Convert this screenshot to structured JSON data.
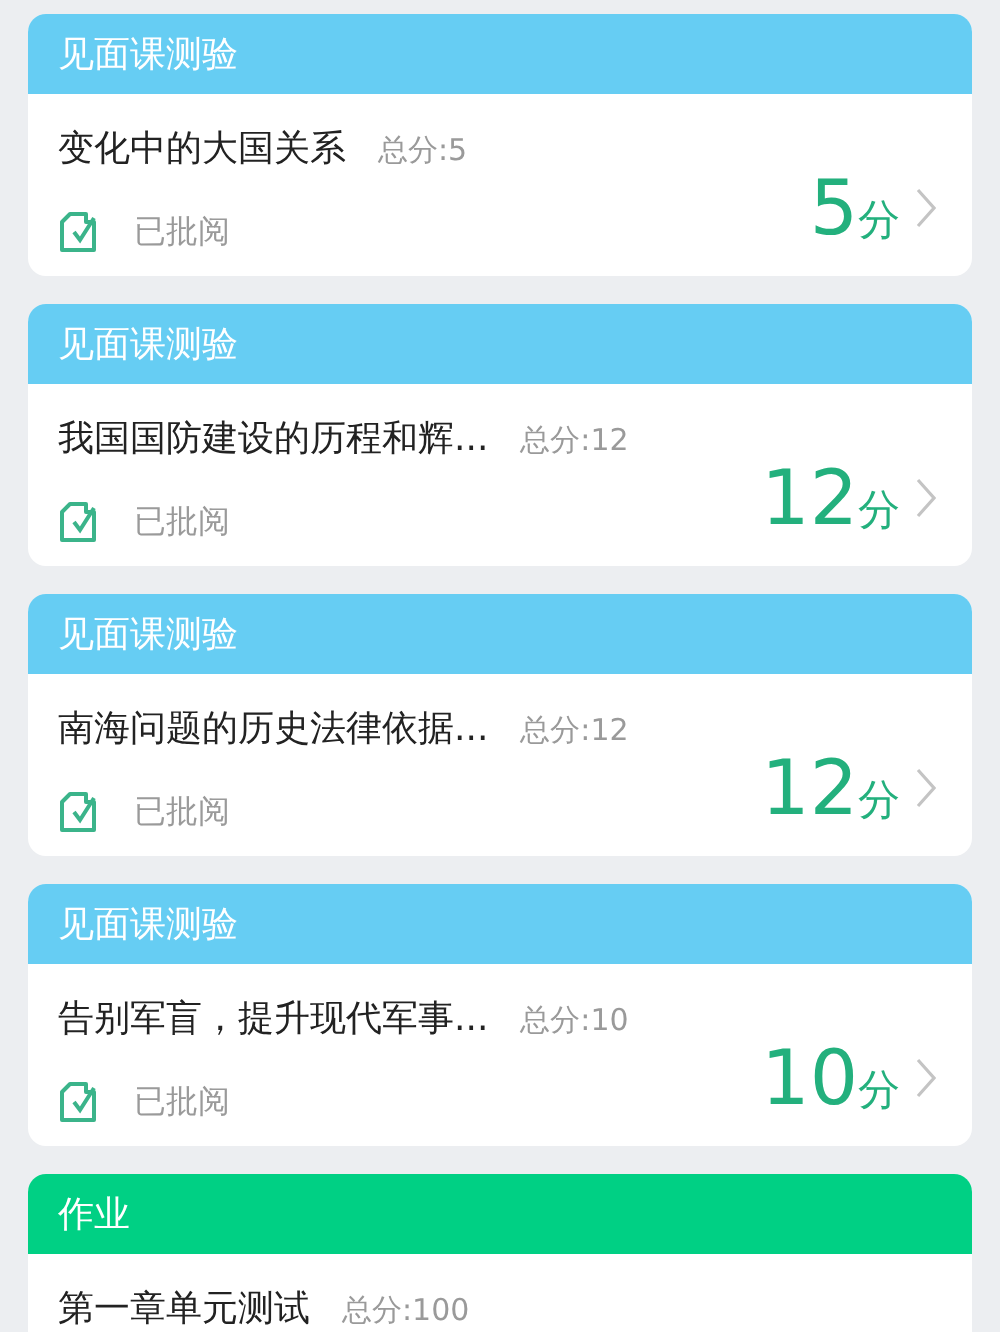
{
  "cards": [
    {
      "category": "见面课测验",
      "color": "#66cdf3",
      "title": "变化中的大国关系",
      "total": "总分:5",
      "status": "已批阅",
      "score": "5",
      "unit": "分"
    },
    {
      "category": "见面课测验",
      "color": "#66cdf3",
      "title": "我国国防建设的历程和辉...",
      "total": "总分:12",
      "status": "已批阅",
      "score": "12",
      "unit": "分"
    },
    {
      "category": "见面课测验",
      "color": "#66cdf3",
      "title": "南海问题的历史法律依据...",
      "total": "总分:12",
      "status": "已批阅",
      "score": "12",
      "unit": "分"
    },
    {
      "category": "见面课测验",
      "color": "#66cdf3",
      "title": "告别军盲，提升现代军事...",
      "total": "总分:10",
      "status": "已批阅",
      "score": "10",
      "unit": "分"
    },
    {
      "category": "作业",
      "color": "#00d084",
      "title": "第一章单元测试",
      "total": "总分:100"
    }
  ]
}
